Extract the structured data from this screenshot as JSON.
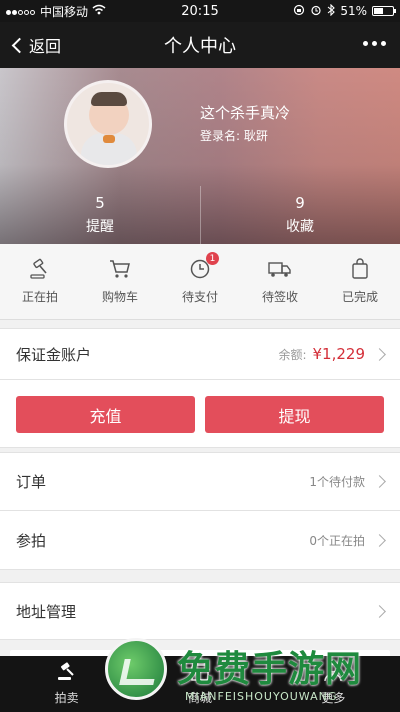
{
  "status_bar": {
    "carrier": "中国移动",
    "time": "20:15",
    "battery": "51%",
    "battery_level": 0.51,
    "icons": [
      "signal-dots-icon",
      "wifi-icon",
      "lock-rotation-icon",
      "alarm-icon",
      "bluetooth-icon",
      "battery-icon"
    ]
  },
  "nav": {
    "back_label": "返回",
    "title": "个人中心",
    "more_icon": "more-dots-icon"
  },
  "profile": {
    "username": "这个杀手真冷",
    "login_label": "登录名:",
    "login_name": "耿趼",
    "stats": [
      {
        "value": "5",
        "label": "提醒"
      },
      {
        "value": "9",
        "label": "收藏"
      }
    ]
  },
  "order_status": [
    {
      "label": "正在拍",
      "icon": "gavel-icon"
    },
    {
      "label": "购物车",
      "icon": "cart-icon"
    },
    {
      "label": "待支付",
      "icon": "clock-icon",
      "badge": "1"
    },
    {
      "label": "待签收",
      "icon": "truck-icon"
    },
    {
      "label": "已完成",
      "icon": "bag-icon"
    }
  ],
  "deposit": {
    "label": "保证金账户",
    "balance_label": "余额:",
    "balance": "¥1,229",
    "accent": "#d42f39"
  },
  "actions": {
    "recharge": "充值",
    "withdraw": "提现",
    "button_color": "#e34e5b"
  },
  "menu": {
    "orders_label": "订单",
    "orders_value": "1个待付款",
    "bidding_label": "参拍",
    "bidding_value": "0个正在拍",
    "address_label": "地址管理"
  },
  "tabs": [
    {
      "label": "拍卖",
      "icon": "gavel-icon"
    },
    {
      "label": "商城",
      "icon": "shop-icon"
    },
    {
      "label": "更多",
      "icon": "user-icon"
    }
  ],
  "watermark": {
    "text_cn": "免费手游网",
    "text_en": "MIANFEISHOUYOUWANG"
  }
}
